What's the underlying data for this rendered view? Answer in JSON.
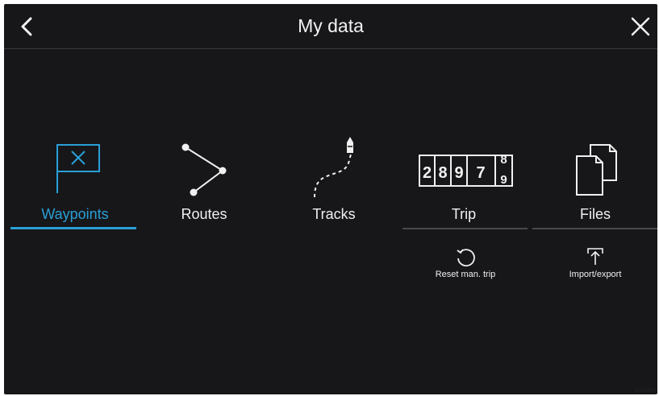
{
  "header": {
    "title": "My data"
  },
  "tiles": [
    {
      "label": "Waypoints",
      "icon": "waypoint-flag-icon",
      "active": true
    },
    {
      "label": "Routes",
      "icon": "route-icon"
    },
    {
      "label": "Tracks",
      "icon": "track-icon"
    },
    {
      "label": "Trip",
      "icon": "trip-counter-icon",
      "counter": [
        "2",
        "8",
        "9",
        "7"
      ],
      "rolling_digits": [
        "8",
        "9"
      ]
    },
    {
      "label": "Files",
      "icon": "files-icon"
    }
  ],
  "actions": [
    {
      "label": "Reset man. trip",
      "icon": "reset-icon"
    },
    {
      "label": "Import/export",
      "icon": "import-export-icon"
    }
  ],
  "footer": {
    "code": "D13691-"
  },
  "colors": {
    "background": "#17171a",
    "accent": "#2a9fd6",
    "text": "#f0f0f0"
  }
}
